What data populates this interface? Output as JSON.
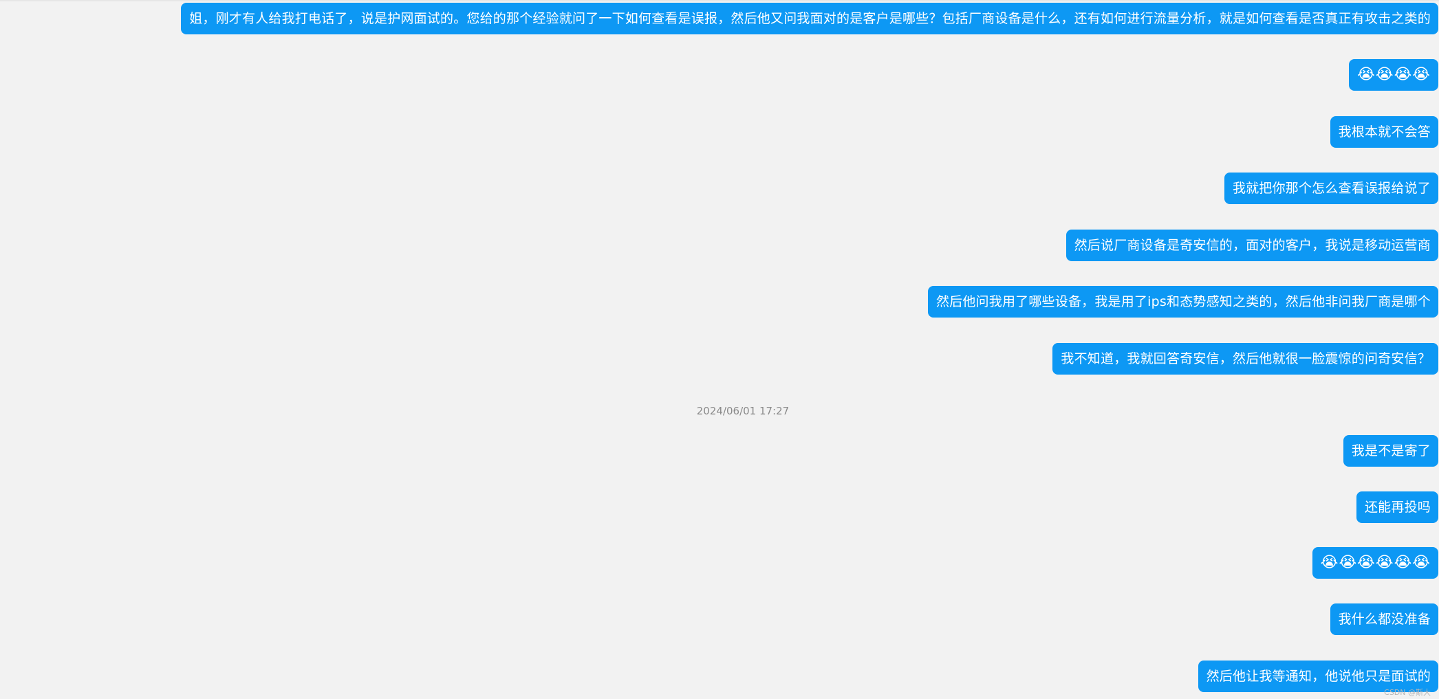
{
  "messages": [
    {
      "text": "姐，刚才有人给我打电话了，说是护网面试的。您给的那个经验就问了一下如何查看是误报，然后他又问我面对的是客户是哪些？包括厂商设备是什么，还有如何进行流量分析，就是如何查看是否真正有攻击之类的",
      "emoji": false
    },
    {
      "text": "😭😭😭😭",
      "emoji": true
    },
    {
      "text": "我根本就不会答",
      "emoji": false
    },
    {
      "text": "我就把你那个怎么查看误报给说了",
      "emoji": false
    },
    {
      "text": "然后说厂商设备是奇安信的，面对的客户，我说是移动运营商",
      "emoji": false
    },
    {
      "text": "然后他问我用了哪些设备，我是用了ips和态势感知之类的，然后他非问我厂商是哪个",
      "emoji": false
    },
    {
      "text": "我不知道，我就回答奇安信，然后他就很一脸震惊的问奇安信？",
      "emoji": false
    },
    {
      "text": "我是不是寄了",
      "emoji": false
    },
    {
      "text": "还能再投吗",
      "emoji": false
    },
    {
      "text": "😭😭😭😭😭😭",
      "emoji": true
    },
    {
      "text": "我什么都没准备",
      "emoji": false
    },
    {
      "text": "然后他让我等通知，他说他只是面试的",
      "emoji": false
    }
  ],
  "timestamp": "2024/06/01 17:27",
  "watermark": "CSDN @斯大",
  "colors": {
    "bubble": "#0d98f4",
    "background": "#f2f2f2",
    "timestamp": "#8a8a8a"
  }
}
